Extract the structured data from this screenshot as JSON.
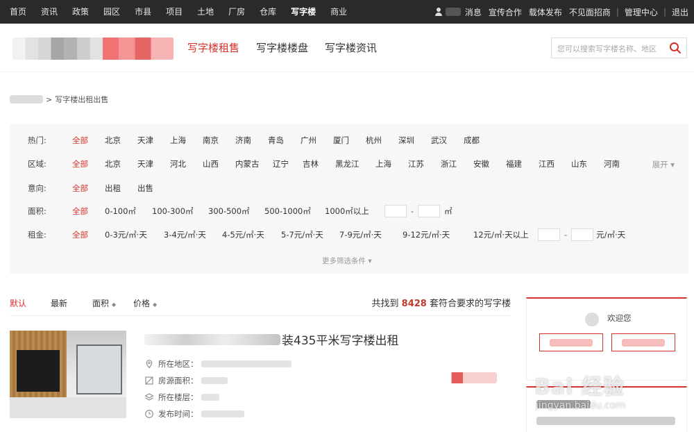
{
  "topbar": {
    "nav": [
      "首页",
      "资讯",
      "政策",
      "园区",
      "市县",
      "项目",
      "土地",
      "厂房",
      "仓库",
      "写字楼",
      "商业"
    ],
    "active_index": 9,
    "right_links": [
      "消息",
      "宣传合作",
      "载体发布",
      "不见面招商",
      "管理中心",
      "退出"
    ]
  },
  "header": {
    "nav": [
      "写字楼租售",
      "写字楼楼盘",
      "写字楼资讯"
    ],
    "active_index": 0,
    "search_placeholder": "您可以搜索写字楼名称、地区"
  },
  "breadcrumb": {
    "separator": ">",
    "current": "写字楼出租出售"
  },
  "filters": {
    "hot": {
      "label": "热门:",
      "options": [
        "全部",
        "北京",
        "天津",
        "上海",
        "南京",
        "济南",
        "青岛",
        "广州",
        "厦门",
        "杭州",
        "深圳",
        "武汉",
        "成都"
      ]
    },
    "region": {
      "label": "区域:",
      "options": [
        "全部",
        "北京",
        "天津",
        "河北",
        "山西",
        "内蒙古",
        "辽宁",
        "吉林",
        "黑龙江",
        "上海",
        "江苏",
        "浙江",
        "安徽",
        "福建",
        "江西",
        "山东",
        "河南"
      ],
      "unfold": "展开"
    },
    "intent": {
      "label": "意向:",
      "options": [
        "全部",
        "出租",
        "出售"
      ]
    },
    "area": {
      "label": "面积:",
      "options": [
        "全部",
        "0-100㎡",
        "100-300㎡",
        "300-500㎡",
        "500-1000㎡",
        "1000㎡以上"
      ],
      "range_sep": "-",
      "unit": "㎡"
    },
    "rent": {
      "label": "租金:",
      "options": [
        "全部",
        "0-3元/㎡·天",
        "3-4元/㎡·天",
        "4-5元/㎡·天",
        "5-7元/㎡·天",
        "7-9元/㎡·天",
        "9-12元/㎡·天",
        "12元/㎡·天以上"
      ],
      "range_sep": "-",
      "unit": "元/㎡·天"
    },
    "more": "更多筛选条件"
  },
  "sort": {
    "options": [
      "默认",
      "最新",
      "面积",
      "价格"
    ],
    "active_index": 0,
    "result_prefix": "共找到",
    "result_count": "8428",
    "result_suffix": "套符合要求的写字楼"
  },
  "listing": {
    "title_visible": "装435平米写字楼出租",
    "attrs": [
      "所在地区：",
      "房源面积：",
      "所在楼层：",
      "发布时间："
    ]
  },
  "sidebar": {
    "welcome": "欢迎您"
  },
  "watermark": {
    "main": "Bai 经验",
    "sub": "jingyan.baidu.com"
  }
}
